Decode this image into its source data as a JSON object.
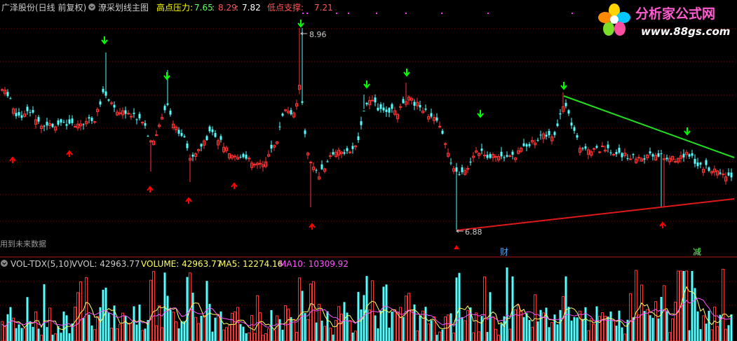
{
  "header": {
    "stock_name": "广泽股份",
    "period": "(日线 前复权)",
    "indicator_name": "潦采划线主图",
    "resistance_label": "高点压力:",
    "resistance_v1": "7.65",
    "resistance_v2": "8.29",
    "resistance_v3": "7.82",
    "support_label": "低点支撑:",
    "support_v1": "7.21",
    "future_data_note": "用到未来数据"
  },
  "price_panel": {
    "high_label": "8.96",
    "low_label": "6.88",
    "marker_cai": "财",
    "marker_jian": "减"
  },
  "volume_panel": {
    "name": "VOL-TDX(5,10)",
    "vvol": "VVOL: 42963.77",
    "volume": "VOLUME: 42963.77",
    "ma5": "MA5: 12274.16",
    "ma10": "MA10: 10309.92"
  },
  "logo": {
    "title": "分析家公式网",
    "url": "www.88gs.com"
  },
  "colors": {
    "up": "#ff3232",
    "down": "#54ffff",
    "green_arrow": "#00ff00",
    "red_arrow": "#ff0000",
    "resistance_line": "#22dd22",
    "support_line": "#e01818",
    "ma5": "#ffff66",
    "ma10": "#ff55ff"
  },
  "chart_data": {
    "type": "candlestick",
    "price": {
      "high": 8.96,
      "low": 6.88
    },
    "resistance_trend_line": {
      "from": "peak after 财 marker",
      "to": "right edge",
      "direction": "down"
    },
    "support_trend_line": {
      "from": 6.88,
      "to": "right edge",
      "direction": "up"
    },
    "indicators": [
      "VOLUME",
      "MA5",
      "MA10"
    ]
  }
}
